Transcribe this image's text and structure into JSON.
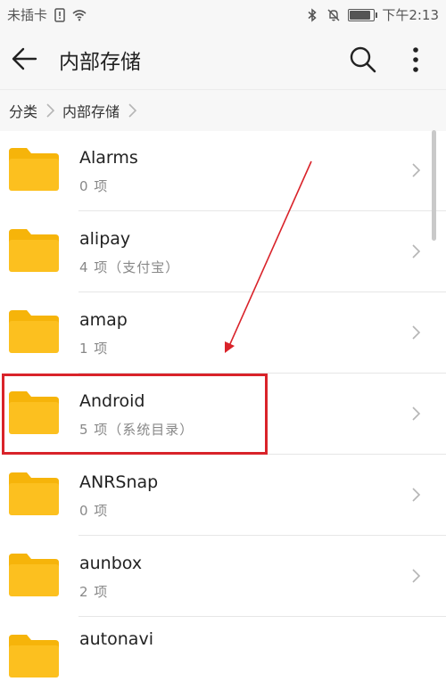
{
  "status_bar": {
    "carrier": "未插卡",
    "time": "下午2:13",
    "battery_level": 0.8
  },
  "header": {
    "title": "内部存储",
    "back_icon": "arrow-left-icon",
    "search_icon": "search-icon",
    "more_icon": "more-vertical-icon"
  },
  "breadcrumb": [
    {
      "label": "分类"
    },
    {
      "label": "内部存储"
    }
  ],
  "files": [
    {
      "name": "Alarms",
      "meta": "0 项"
    },
    {
      "name": "alipay",
      "meta": "4 项（支付宝）"
    },
    {
      "name": "amap",
      "meta": "1 项"
    },
    {
      "name": "Android",
      "meta": "5 项（系统目录）"
    },
    {
      "name": "ANRSnap",
      "meta": "0 项"
    },
    {
      "name": "aunbox",
      "meta": "2 项"
    },
    {
      "name": "autonavi",
      "meta": ""
    }
  ],
  "colors": {
    "folder": "#fcc01f",
    "folder_tab": "#f6b40a",
    "annotation": "#d9232a"
  },
  "annotation": {
    "highlighted_item": "Android"
  }
}
